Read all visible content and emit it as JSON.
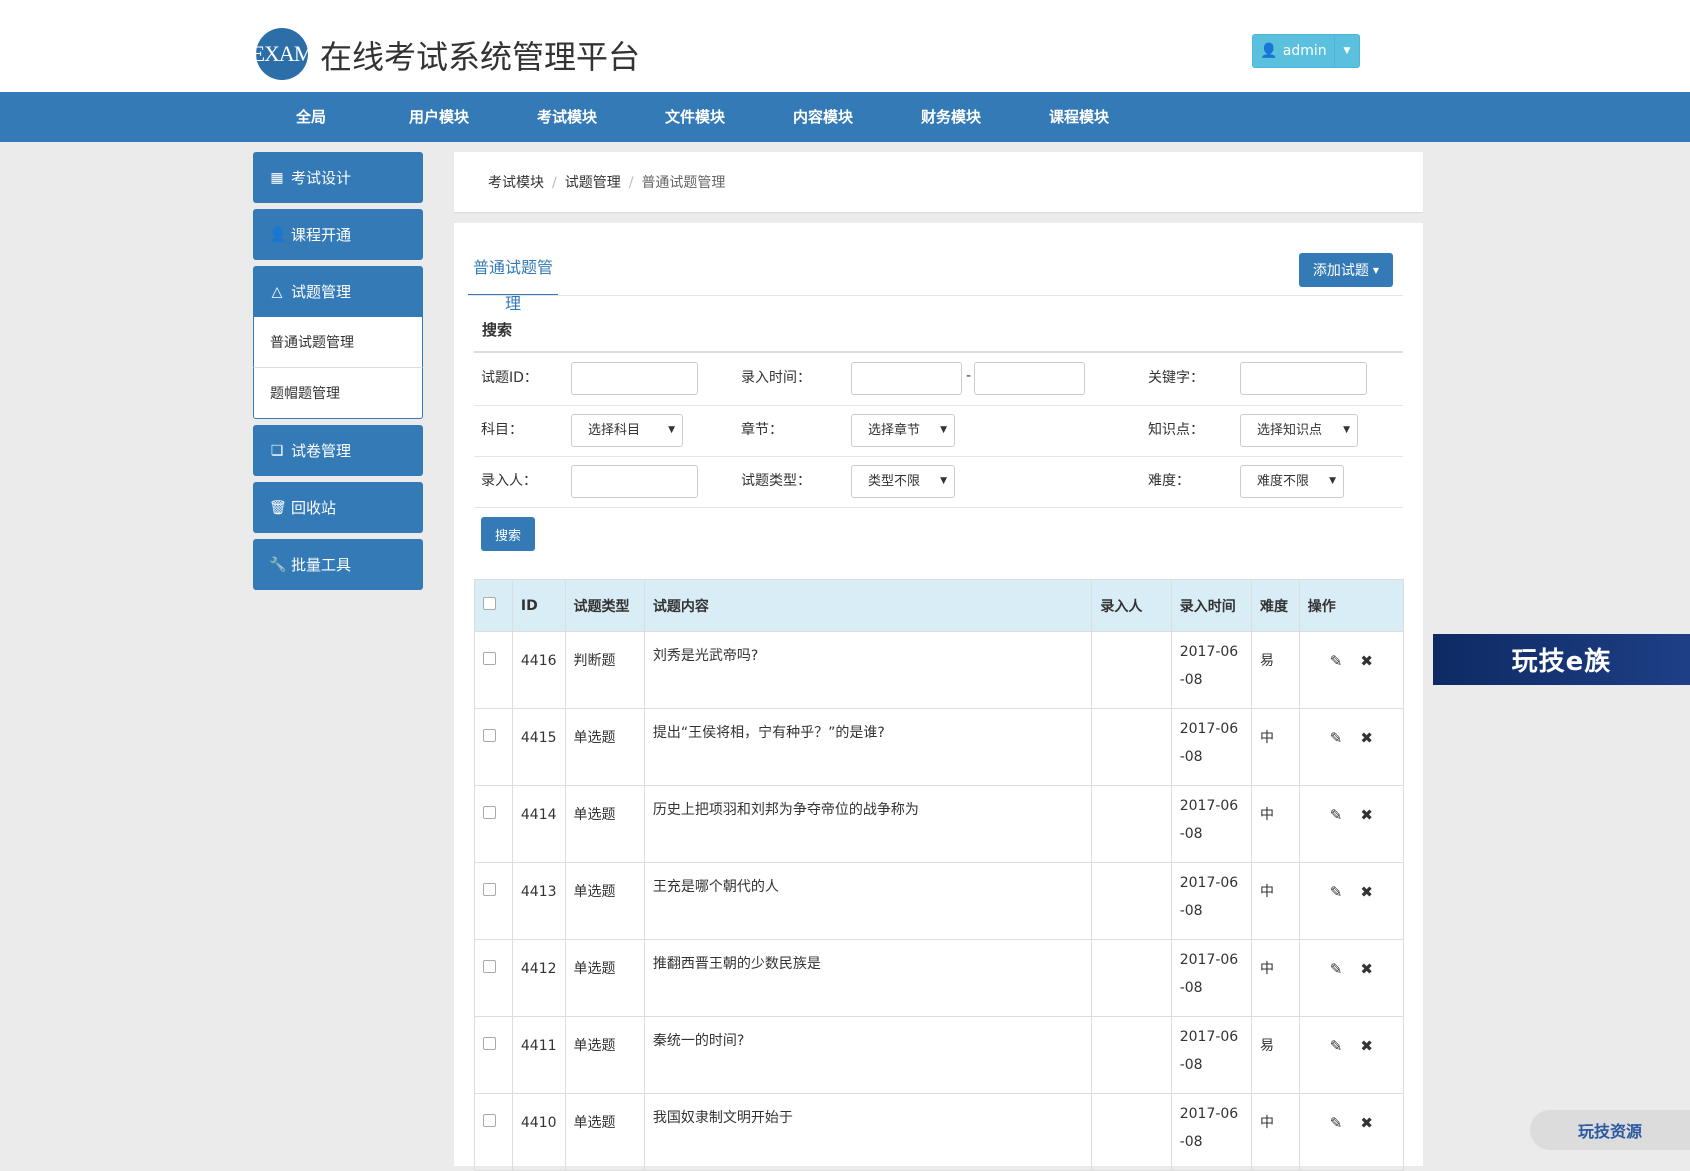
{
  "header": {
    "logo_text": "EXAM",
    "title": "在线考试系统管理平台",
    "user_label": "admin"
  },
  "nav": [
    "全局",
    "用户模块",
    "考试模块",
    "文件模块",
    "内容模块",
    "财务模块",
    "课程模块"
  ],
  "sidebar": {
    "items": [
      {
        "label": "考试设计",
        "icon": "grid-icon"
      },
      {
        "label": "课程开通",
        "icon": "user-icon"
      },
      {
        "label": "试题管理",
        "icon": "flask-icon"
      },
      {
        "label": "试卷管理",
        "icon": "copy-icon"
      },
      {
        "label": "回收站",
        "icon": "trash-icon"
      },
      {
        "label": "批量工具",
        "icon": "wrench-icon"
      }
    ],
    "subitems": [
      "普通试题管理",
      "题帽题管理"
    ]
  },
  "breadcrumb": [
    "考试模块",
    "试题管理",
    "普通试题管理"
  ],
  "main": {
    "tab": "普通试题管理",
    "add_button": "添加试题"
  },
  "search": {
    "title": "搜索",
    "labels": {
      "id": "试题ID：",
      "time": "录入时间：",
      "keyword": "关键字：",
      "subject": "科目：",
      "chapter": "章节：",
      "knowledge": "知识点：",
      "creator": "录入人：",
      "type": "试题类型：",
      "difficulty": "难度："
    },
    "selects": {
      "subject": "选择科目",
      "chapter": "选择章节",
      "knowledge": "选择知识点",
      "type": "类型不限",
      "difficulty": "难度不限"
    },
    "button": "搜索"
  },
  "table": {
    "headers": [
      "ID",
      "试题类型",
      "试题内容",
      "录入人",
      "录入时间",
      "难度",
      "操作"
    ],
    "rows": [
      {
        "id": "4416",
        "type": "判断题",
        "content": "刘秀是光武帝吗?",
        "creator": "",
        "time": "2017-06-08",
        "difficulty": "易"
      },
      {
        "id": "4415",
        "type": "单选题",
        "content": "提出“王侯将相，宁有种乎？”的是谁?",
        "creator": "",
        "time": "2017-06-08",
        "difficulty": "中"
      },
      {
        "id": "4414",
        "type": "单选题",
        "content": "历史上把项羽和刘邦为争夺帝位的战争称为",
        "creator": "",
        "time": "2017-06-08",
        "difficulty": "中"
      },
      {
        "id": "4413",
        "type": "单选题",
        "content": "王充是哪个朝代的人",
        "creator": "",
        "time": "2017-06-08",
        "difficulty": "中"
      },
      {
        "id": "4412",
        "type": "单选题",
        "content": "推翻西晋王朝的少数民族是",
        "creator": "",
        "time": "2017-06-08",
        "difficulty": "中"
      },
      {
        "id": "4411",
        "type": "单选题",
        "content": "秦统一的时间?",
        "creator": "",
        "time": "2017-06-08",
        "difficulty": "易"
      },
      {
        "id": "4410",
        "type": "单选题",
        "content": "我国奴隶制文明开始于",
        "creator": "",
        "time": "2017-06-08",
        "difficulty": "中"
      }
    ]
  },
  "ads": {
    "right": "玩技e族",
    "bottom": "玩技资源"
  }
}
